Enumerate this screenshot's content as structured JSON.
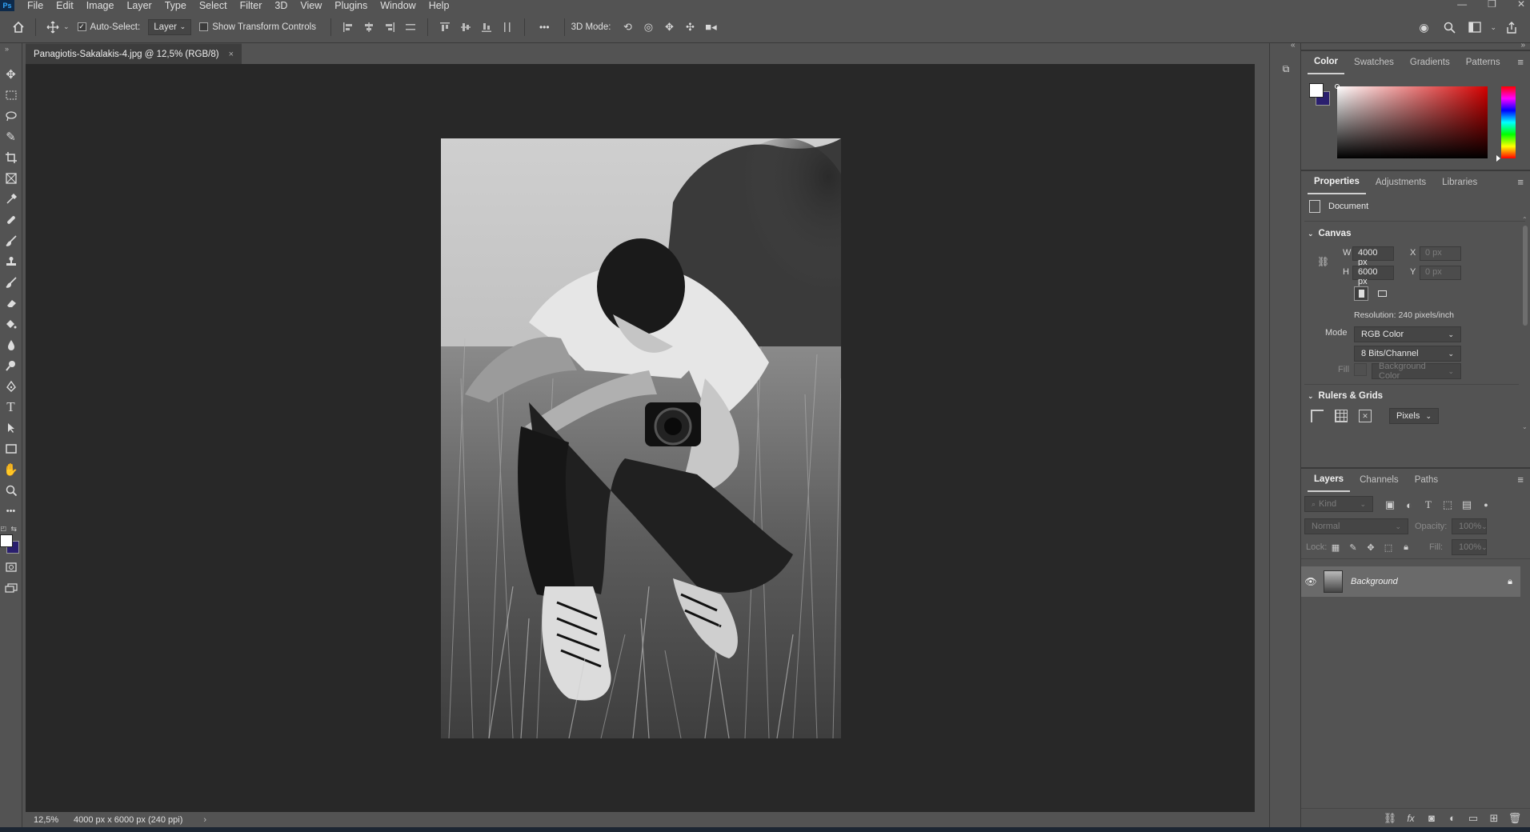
{
  "app": {
    "logo": "Ps",
    "menu": [
      "File",
      "Edit",
      "Image",
      "Layer",
      "Type",
      "Select",
      "Filter",
      "3D",
      "View",
      "Plugins",
      "Window",
      "Help"
    ],
    "window_controls": [
      "—",
      "❐",
      "✕"
    ]
  },
  "options_bar": {
    "auto_select_label": "Auto-Select:",
    "auto_select_checked": true,
    "auto_select_target": "Layer",
    "transform_controls_label": "Show Transform Controls",
    "more": "•••",
    "mode_3d_label": "3D Mode:"
  },
  "document": {
    "tab_title": "Panagiotis-Sakalakis-4.jpg @ 12,5% (RGB/8)",
    "tab_close": "×",
    "zoom": "12,5%",
    "dimensions_info": "4000 px x 6000 px (240 ppi)",
    "status_arrow": "›"
  },
  "color_panel": {
    "tabs": [
      "Color",
      "Swatches",
      "Gradients",
      "Patterns"
    ],
    "foreground": "#ffffff",
    "background": "#2a1f6e",
    "hue_color": "#d40000"
  },
  "properties_panel": {
    "tabs": [
      "Properties",
      "Adjustments",
      "Libraries"
    ],
    "doc_label": "Document",
    "canvas": {
      "heading": "Canvas",
      "w_label": "W",
      "w_value": "4000 px",
      "h_label": "H",
      "h_value": "6000 px",
      "x_label": "X",
      "x_placeholder": "0 px",
      "y_label": "Y",
      "y_placeholder": "0 px",
      "resolution": "Resolution: 240 pixels/inch",
      "mode_label": "Mode",
      "mode_value": "RGB Color",
      "bits_value": "8 Bits/Channel",
      "fill_label": "Fill",
      "fill_value": "Background Color"
    },
    "rulers": {
      "heading": "Rulers & Grids",
      "units": "Pixels"
    }
  },
  "layers_panel": {
    "tabs": [
      "Layers",
      "Channels",
      "Paths"
    ],
    "filter_placeholder": "Kind",
    "blend_mode": "Normal",
    "opacity_label": "Opacity:",
    "opacity_value": "100%",
    "lock_label": "Lock:",
    "fill_label": "Fill:",
    "fill_value": "100%",
    "layers": [
      {
        "name": "Background",
        "visible": true,
        "locked": true
      }
    ],
    "footer_icons": [
      "link-icon",
      "fx-icon",
      "mask-icon",
      "adjustment-icon",
      "folder-icon",
      "new-layer-icon",
      "trash-icon"
    ],
    "footer_fx": "fx"
  }
}
